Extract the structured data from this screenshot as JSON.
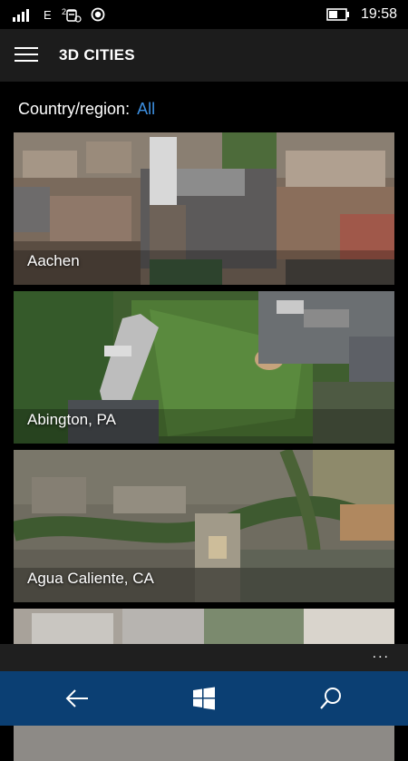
{
  "status_bar": {
    "network_type": "E",
    "time": "19:58",
    "icons": [
      "signal-icon",
      "wifi-call-icon",
      "location-icon",
      "battery-icon"
    ]
  },
  "header": {
    "title": "3D CITIES",
    "menu_icon": "hamburger-icon"
  },
  "filter": {
    "label": "Country/region:",
    "value": "All"
  },
  "cities": [
    {
      "name": "Aachen"
    },
    {
      "name": "Abington, PA"
    },
    {
      "name": "Agua Caliente, CA"
    },
    {
      "name": ""
    }
  ],
  "app_bar": {
    "more_label": "..."
  },
  "nav_bar": {
    "icons": [
      "back-arrow-icon",
      "windows-logo-icon",
      "search-icon"
    ],
    "accent": "#0b3f73"
  },
  "colors": {
    "accent_link": "#3d8fe0",
    "header_bg": "#1c1c1c",
    "background": "#000000"
  }
}
